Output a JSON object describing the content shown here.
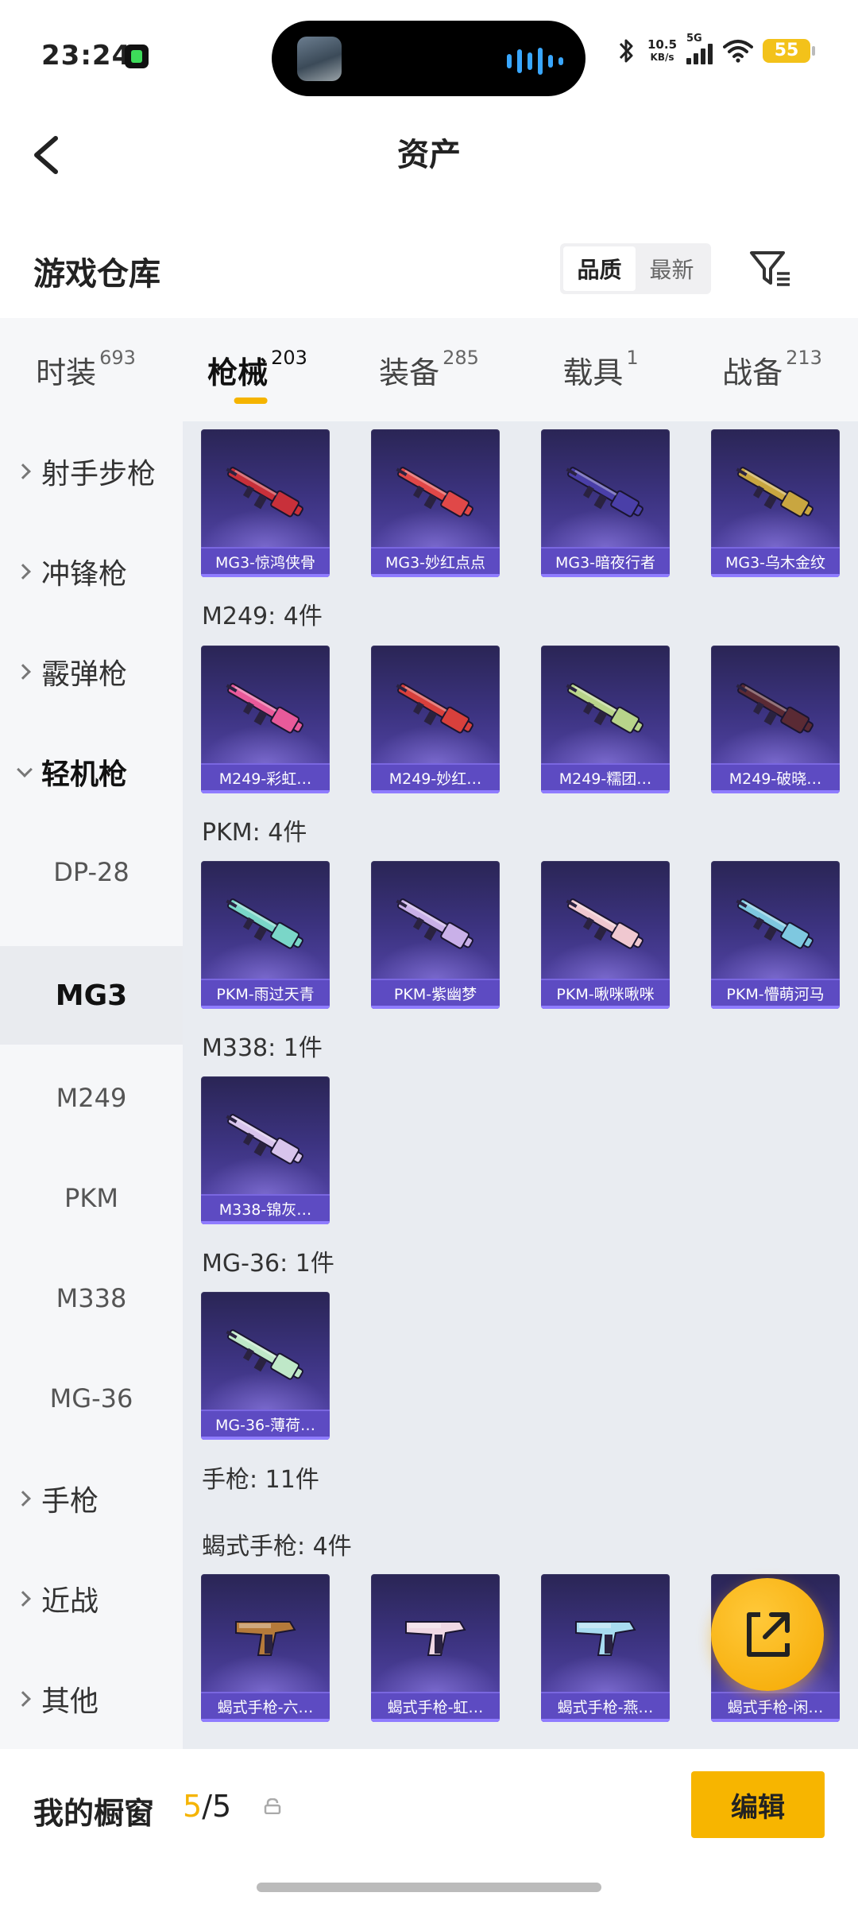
{
  "status_bar": {
    "time": "23:24",
    "net_speed_value": "10.5",
    "net_speed_unit": "KB/s",
    "signal_label": "5G",
    "battery": "55"
  },
  "header": {
    "title": "资产"
  },
  "warehouse": {
    "title": "游戏仓库",
    "sort_options": [
      "品质",
      "最新"
    ],
    "active_sort": "品质"
  },
  "tabs": [
    {
      "label": "时装",
      "count": "693"
    },
    {
      "label": "枪械",
      "count": "203",
      "active": true
    },
    {
      "label": "装备",
      "count": "285"
    },
    {
      "label": "载具",
      "count": "1"
    },
    {
      "label": "战备",
      "count": "213"
    }
  ],
  "sidebar": {
    "categories": [
      {
        "label": "射手步枪"
      },
      {
        "label": "冲锋枪"
      },
      {
        "label": "霰弹枪"
      },
      {
        "label": "轻机枪",
        "expanded": true
      }
    ],
    "subitems": [
      {
        "label": "DP-28"
      },
      {
        "label": "MG3",
        "active": true
      },
      {
        "label": "M249"
      },
      {
        "label": "PKM"
      },
      {
        "label": "M338"
      },
      {
        "label": "MG-36"
      }
    ],
    "more_categories": [
      {
        "label": "手枪"
      },
      {
        "label": "近战"
      },
      {
        "label": "其他"
      }
    ]
  },
  "groups": {
    "mg3": {
      "items": [
        "MG3-惊鸿侠骨",
        "MG3-妙红点点",
        "MG3-暗夜行者",
        "MG3-乌木金纹"
      ]
    },
    "m249": {
      "title": "M249: 4件",
      "items": [
        "M249-彩虹…",
        "M249-妙红…",
        "M249-糯团…",
        "M249-破晓…"
      ]
    },
    "pkm": {
      "title": "PKM: 4件",
      "items": [
        "PKM-雨过天青",
        "PKM-紫幽梦",
        "PKM-啾咪啾咪",
        "PKM-懵萌河马"
      ]
    },
    "m338": {
      "title": "M338: 1件",
      "items": [
        "M338-锦灰…"
      ]
    },
    "mg36": {
      "title": "MG-36: 1件",
      "items": [
        "MG-36-薄荷…"
      ]
    },
    "pistol": {
      "title": "手枪: 11件"
    },
    "scorpion": {
      "title": "蝎式手枪: 4件",
      "items": [
        "蝎式手枪-六…",
        "蝎式手枪-虹…",
        "蝎式手枪-燕…",
        "蝎式手枪-闲…"
      ]
    }
  },
  "bottom_bar": {
    "window_label": "我的橱窗",
    "window_current": "5",
    "window_total": "/5",
    "edit_label": "编辑"
  },
  "colors": {
    "accent": "#f5b400",
    "card_bg": "#3c3380",
    "card_caption": "#5d4bc2",
    "content_bg": "#e9ecf1",
    "sidebar_bg": "#f6f7f9"
  },
  "gun_colors": {
    "mg3": [
      "#c8303a",
      "#e04848",
      "#4a3fa8",
      "#c9a640"
    ],
    "m249": [
      "#e85a9a",
      "#d8403c",
      "#b8d48a",
      "#5a2a34"
    ],
    "pkm": [
      "#7ad6c8",
      "#c9b0e8",
      "#f0c8d0",
      "#7ec8e0"
    ],
    "m338": [
      "#d8c4ec"
    ],
    "mg36": [
      "#bfe8c8"
    ],
    "scorpion": [
      "#b57a3a",
      "#f0d8e4",
      "#a8dcf0",
      "#e8e0f0"
    ]
  }
}
